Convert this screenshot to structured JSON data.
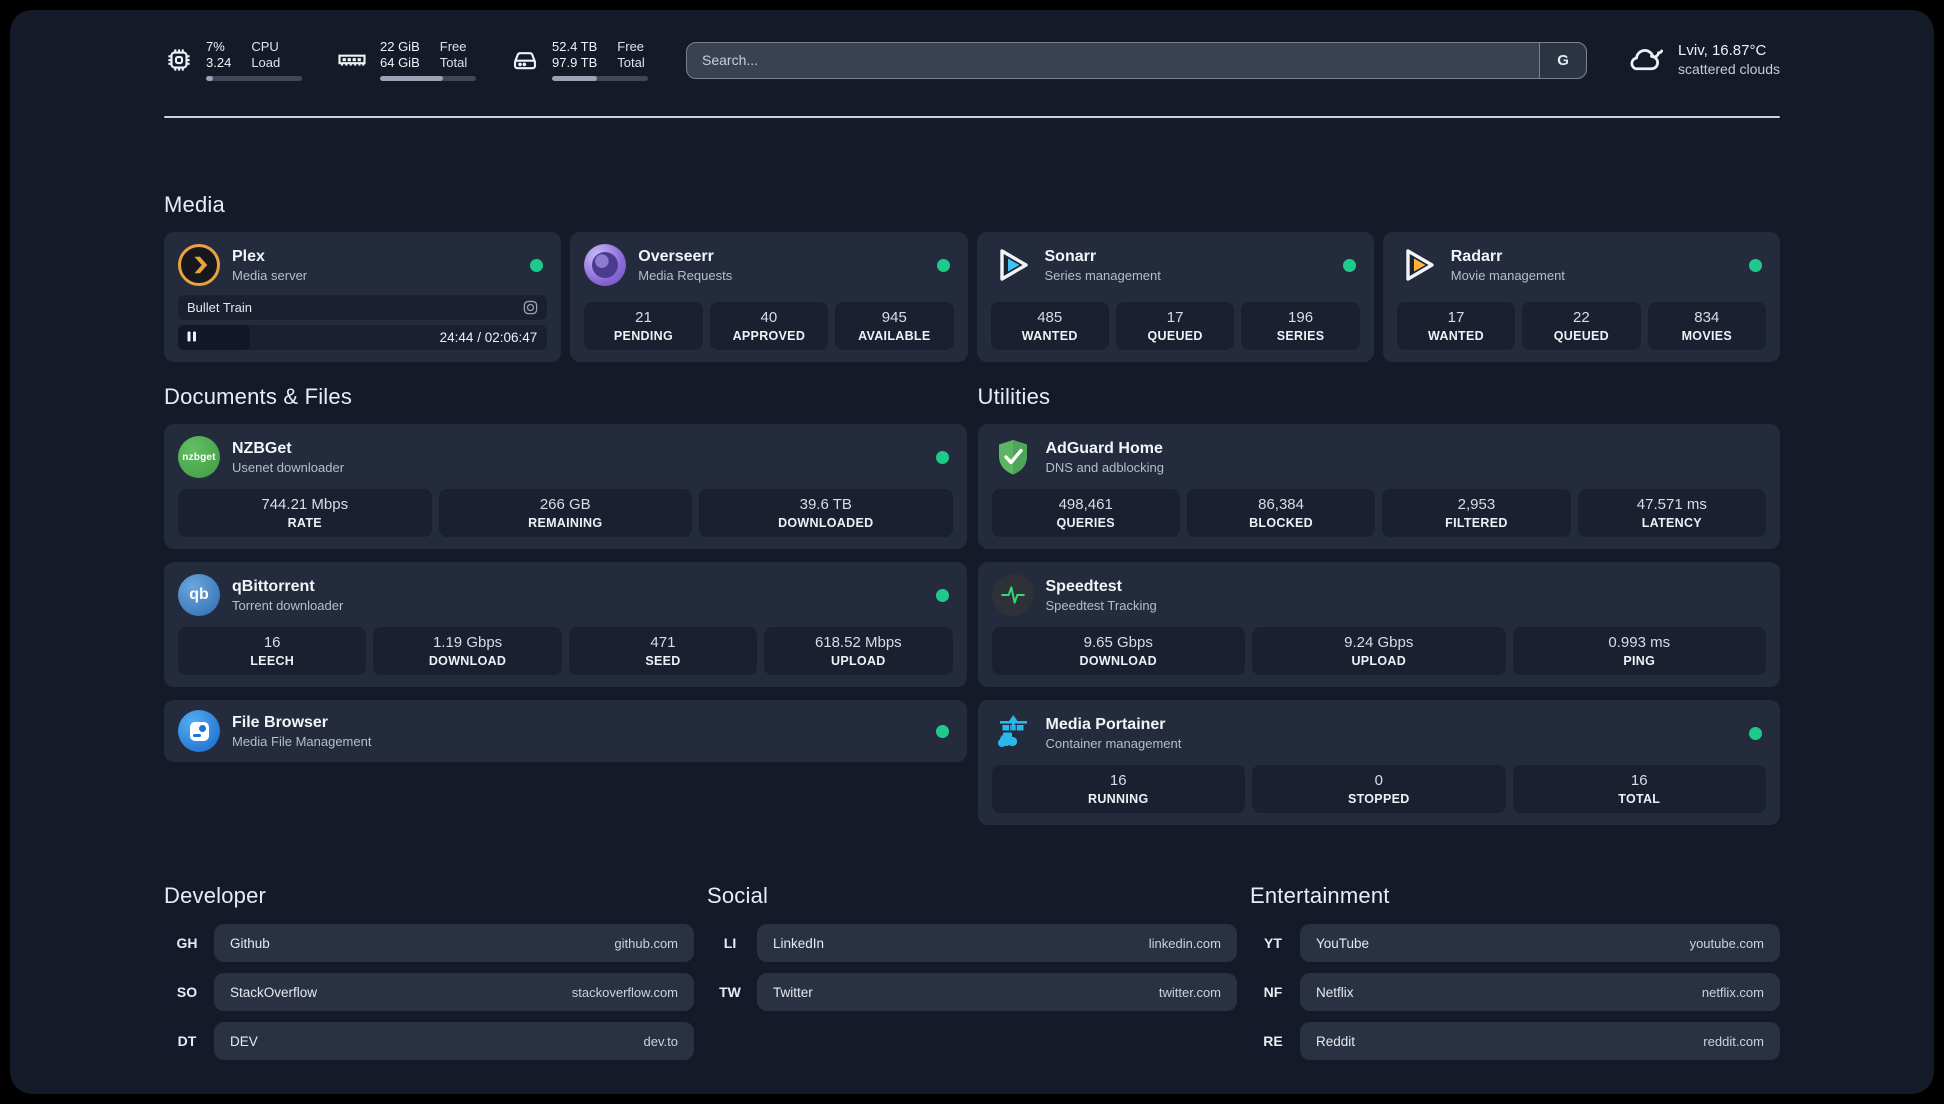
{
  "topbar": {
    "stats": [
      {
        "icon": "cpu-icon",
        "value1": "7%",
        "value2": "3.24",
        "label1": "CPU",
        "label2": "Load",
        "progress": 7
      },
      {
        "icon": "memory-icon",
        "value1": "22 GiB",
        "value2": "64 GiB",
        "label1": "Free",
        "label2": "Total",
        "progress": 66
      },
      {
        "icon": "disk-icon",
        "value1": "52.4 TB",
        "value2": "97.9 TB",
        "label1": "Free",
        "label2": "Total",
        "progress": 47
      }
    ],
    "search": {
      "placeholder": "Search...",
      "button_label": "G"
    },
    "weather": {
      "icon": "cloud-icon",
      "title": "Lviv, 16.87°C",
      "subtitle": "scattered clouds"
    }
  },
  "sections": {
    "media": {
      "title": "Media"
    },
    "documents": {
      "title": "Documents & Files"
    },
    "utilities": {
      "title": "Utilities"
    },
    "developer": {
      "title": "Developer"
    },
    "social": {
      "title": "Social"
    },
    "entertainment": {
      "title": "Entertainment"
    }
  },
  "services": {
    "plex": {
      "icon": "plex-icon",
      "title": "Plex",
      "subtitle": "Media server",
      "online": true,
      "now_playing": {
        "title": "Bullet Train",
        "time_display": "24:44 / 02:06:47",
        "progress": 19.5
      }
    },
    "overseerr": {
      "icon": "overseerr-icon",
      "title": "Overseerr",
      "subtitle": "Media Requests",
      "online": true,
      "stats": [
        {
          "value": "21",
          "label": "PENDING"
        },
        {
          "value": "40",
          "label": "APPROVED"
        },
        {
          "value": "945",
          "label": "AVAILABLE"
        }
      ]
    },
    "sonarr": {
      "icon": "sonarr-icon",
      "title": "Sonarr",
      "subtitle": "Series management",
      "online": true,
      "stats": [
        {
          "value": "485",
          "label": "WANTED"
        },
        {
          "value": "17",
          "label": "QUEUED"
        },
        {
          "value": "196",
          "label": "SERIES"
        }
      ]
    },
    "radarr": {
      "icon": "radarr-icon",
      "title": "Radarr",
      "subtitle": "Movie management",
      "online": true,
      "stats": [
        {
          "value": "17",
          "label": "WANTED"
        },
        {
          "value": "22",
          "label": "QUEUED"
        },
        {
          "value": "834",
          "label": "MOVIES"
        }
      ]
    },
    "nzbget": {
      "icon": "nzbget-icon",
      "icon_text": "nzbget",
      "title": "NZBGet",
      "subtitle": "Usenet downloader",
      "online": true,
      "stats": [
        {
          "value": "744.21 Mbps",
          "label": "RATE"
        },
        {
          "value": "266 GB",
          "label": "REMAINING"
        },
        {
          "value": "39.6 TB",
          "label": "DOWNLOADED"
        }
      ]
    },
    "qbittorrent": {
      "icon": "qbittorrent-icon",
      "icon_text": "qb",
      "title": "qBittorrent",
      "subtitle": "Torrent downloader",
      "online": true,
      "stats": [
        {
          "value": "16",
          "label": "LEECH"
        },
        {
          "value": "1.19 Gbps",
          "label": "DOWNLOAD"
        },
        {
          "value": "471",
          "label": "SEED"
        },
        {
          "value": "618.52 Mbps",
          "label": "UPLOAD"
        }
      ]
    },
    "filebrowser": {
      "icon": "filebrowser-icon",
      "title": "File Browser",
      "subtitle": "Media File Management",
      "online": true
    },
    "adguard": {
      "icon": "adguard-icon",
      "title": "AdGuard Home",
      "subtitle": "DNS and adblocking",
      "stats": [
        {
          "value": "498,461",
          "label": "QUERIES"
        },
        {
          "value": "86,384",
          "label": "BLOCKED"
        },
        {
          "value": "2,953",
          "label": "FILTERED"
        },
        {
          "value": "47.571 ms",
          "label": "LATENCY"
        }
      ]
    },
    "speedtest": {
      "icon": "speedtest-icon",
      "title": "Speedtest",
      "subtitle": "Speedtest Tracking",
      "stats": [
        {
          "value": "9.65 Gbps",
          "label": "DOWNLOAD"
        },
        {
          "value": "9.24 Gbps",
          "label": "UPLOAD"
        },
        {
          "value": "0.993 ms",
          "label": "PING"
        }
      ]
    },
    "portainer": {
      "icon": "portainer-icon",
      "title": "Media Portainer",
      "subtitle": "Container management",
      "online": true,
      "stats": [
        {
          "value": "16",
          "label": "RUNNING"
        },
        {
          "value": "0",
          "label": "STOPPED"
        },
        {
          "value": "16",
          "label": "TOTAL"
        }
      ]
    }
  },
  "bookmarks": {
    "developer": [
      {
        "abbr": "GH",
        "name": "Github",
        "url": "github.com"
      },
      {
        "abbr": "SO",
        "name": "StackOverflow",
        "url": "stackoverflow.com"
      },
      {
        "abbr": "DT",
        "name": "DEV",
        "url": "dev.to"
      }
    ],
    "social": [
      {
        "abbr": "LI",
        "name": "LinkedIn",
        "url": "linkedin.com"
      },
      {
        "abbr": "TW",
        "name": "Twitter",
        "url": "twitter.com"
      }
    ],
    "entertainment": [
      {
        "abbr": "YT",
        "name": "YouTube",
        "url": "youtube.com"
      },
      {
        "abbr": "NF",
        "name": "Netflix",
        "url": "netflix.com"
      },
      {
        "abbr": "RE",
        "name": "Reddit",
        "url": "reddit.com"
      }
    ]
  },
  "colors": {
    "status_online": "#1ec98c",
    "plex_amber": "#e8a33d",
    "sonarr_blue": "#3cc5f5",
    "radarr_amber": "#ffb53c",
    "portainer_blue": "#29b8eb",
    "background": "#151a29",
    "card": "#242b3c"
  }
}
